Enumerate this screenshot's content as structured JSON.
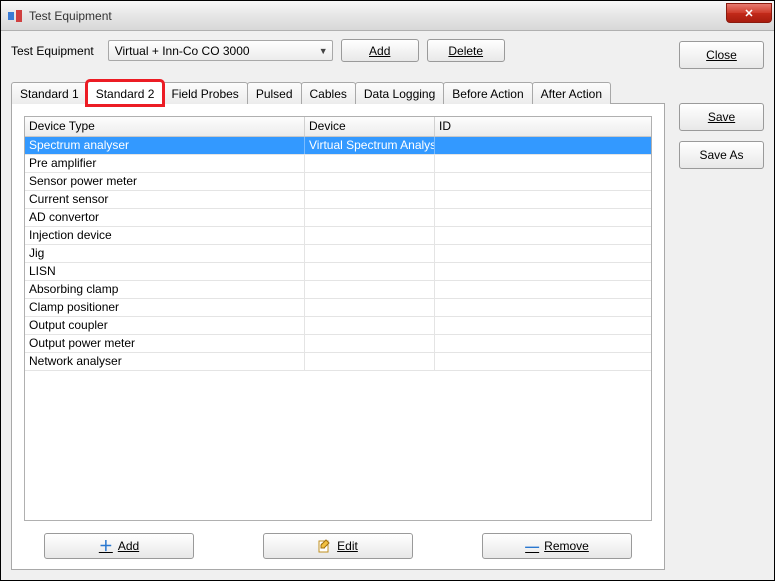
{
  "window": {
    "title": "Test Equipment"
  },
  "top": {
    "label": "Test Equipment",
    "combo_value": "Virtual + Inn-Co CO 3000",
    "add": "Add",
    "delete": "Delete"
  },
  "side": {
    "close": "Close",
    "save": "Save",
    "save_as": "Save As"
  },
  "tabs": [
    {
      "label": "Standard 1"
    },
    {
      "label": "Standard 2"
    },
    {
      "label": "Field Probes"
    },
    {
      "label": "Pulsed"
    },
    {
      "label": "Cables"
    },
    {
      "label": "Data Logging"
    },
    {
      "label": "Before Action"
    },
    {
      "label": "After Action"
    }
  ],
  "active_tab": 1,
  "highlight_tab": 1,
  "grid": {
    "cols": [
      "Device Type",
      "Device",
      "ID"
    ],
    "rows": [
      {
        "type": "Spectrum analyser",
        "device": "Virtual Spectrum Analyser",
        "id": "",
        "selected": true
      },
      {
        "type": "Pre amplifier",
        "device": "",
        "id": ""
      },
      {
        "type": "Sensor power meter",
        "device": "",
        "id": ""
      },
      {
        "type": "Current sensor",
        "device": "",
        "id": ""
      },
      {
        "type": "AD convertor",
        "device": "",
        "id": ""
      },
      {
        "type": "Injection device",
        "device": "",
        "id": ""
      },
      {
        "type": "Jig",
        "device": "",
        "id": ""
      },
      {
        "type": "LISN",
        "device": "",
        "id": ""
      },
      {
        "type": "Absorbing clamp",
        "device": "",
        "id": ""
      },
      {
        "type": "Clamp positioner",
        "device": "",
        "id": ""
      },
      {
        "type": "Output coupler",
        "device": "",
        "id": ""
      },
      {
        "type": "Output power meter",
        "device": "",
        "id": ""
      },
      {
        "type": "Network analyser",
        "device": "",
        "id": ""
      }
    ]
  },
  "bottom": {
    "add": "Add",
    "edit": "Edit",
    "remove": "Remove"
  }
}
